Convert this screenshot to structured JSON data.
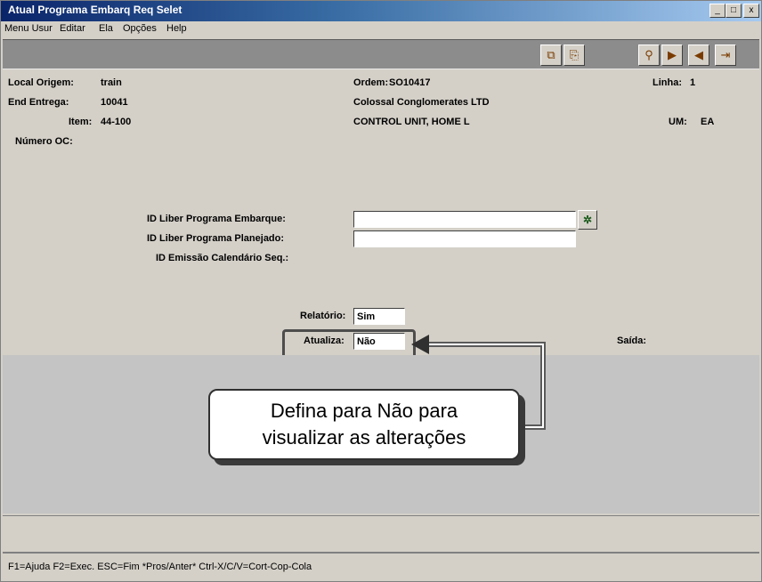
{
  "window": {
    "title": "Atual Programa Embarq Req Selet",
    "buttons": [
      "_",
      "□",
      "x"
    ]
  },
  "menu": {
    "items": [
      "Menu Usur",
      "Editar",
      "Ela",
      "Opções",
      "Help"
    ]
  },
  "toolbar": {
    "icons": [
      "copy-icon",
      "paste-icon",
      "find-icon",
      "next-icon",
      "prev-icon",
      "exit-icon"
    ]
  },
  "form": {
    "local_origem_label": "Local Origem:",
    "local_origem_value": "train",
    "ordem_label": "Ordem:",
    "ordem_value": "SO10417",
    "linha_label": "Linha:",
    "linha_value": "1",
    "end_entrega_label": "End Entrega:",
    "end_entrega_value": "10041",
    "company_value": "Colossal Conglomerates LTD",
    "item_label": "Item:",
    "item_value": "44-100",
    "item_desc_value": "CONTROL UNIT, HOME L",
    "um_label": "UM:",
    "um_value": "EA",
    "numero_oc_label": "Número OC:",
    "id_liber_embarque_label": "ID Liber Programa Embarque:",
    "id_liber_embarque_value": "",
    "id_liber_planejado_label": "ID Liber Programa Planejado:",
    "id_liber_planejado_value": "",
    "id_emissao_label": "ID Emissão Calendário Seq.:",
    "relatorio_label": "Relatório:",
    "relatorio_value": "Sim",
    "atualiza_label": "Atualiza:",
    "atualiza_value": "Não",
    "saida_label": "Saída:"
  },
  "callout": {
    "line1": "Defina para Não para",
    "line2": "visualizar as alterações"
  },
  "status": {
    "text": "F1=Ajuda F2=Exec. ESC=Fim *Pros/Anter* Ctrl-X/C/V=Cort-Cop-Cola"
  }
}
